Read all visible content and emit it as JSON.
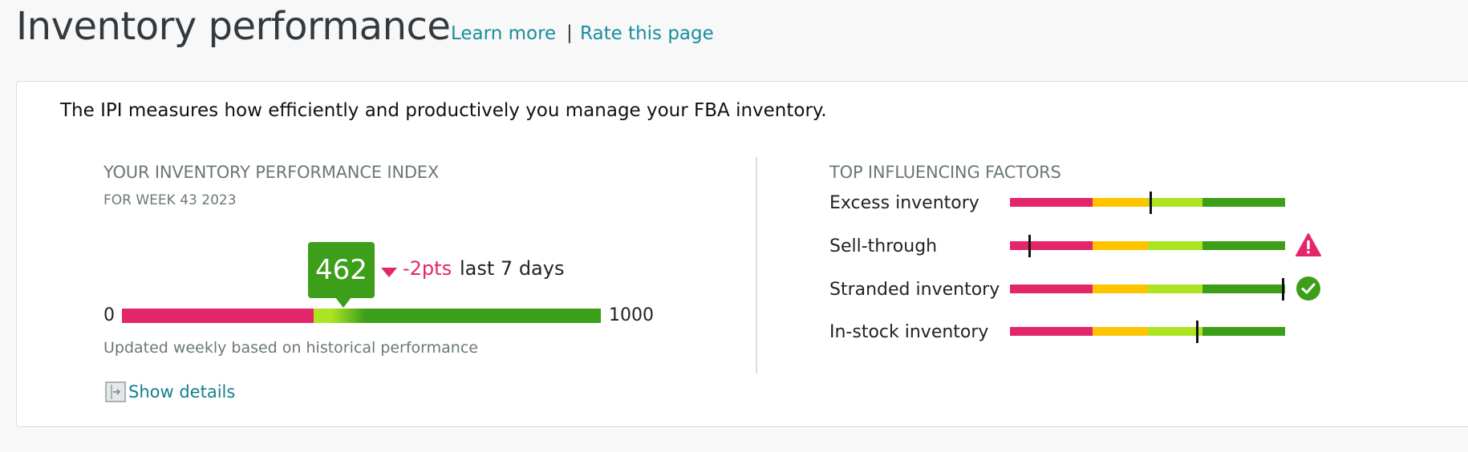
{
  "header": {
    "title": "Inventory performance",
    "learn_more": "Learn more",
    "separator": "|",
    "rate_page": "Rate this page"
  },
  "intro": "The IPI measures how efficiently and productively you manage your FBA inventory.",
  "ipi": {
    "heading": "YOUR INVENTORY PERFORMANCE INDEX",
    "period": "FOR WEEK 43 2023",
    "score": "462",
    "score_value": 462,
    "scale_min": "0",
    "scale_max": "1000",
    "scale_min_value": 0,
    "scale_max_value": 1000,
    "threshold_value": 400,
    "delta_direction": "down",
    "delta": "-2pts",
    "delta_period": "last 7 days",
    "updated_note": "Updated weekly based on historical performance",
    "show_details": "Show details",
    "colors": {
      "low": "#e3266a",
      "mid": "#ade422",
      "high": "#3d9e1a"
    }
  },
  "factors": {
    "heading": "TOP INFLUENCING FACTORS",
    "segments": [
      {
        "name": "poor",
        "fraction": 0.3,
        "color": "#e3266a"
      },
      {
        "name": "fair",
        "fraction": 0.2,
        "color": "#ffc400"
      },
      {
        "name": "good",
        "fraction": 0.2,
        "color": "#ade422"
      },
      {
        "name": "great",
        "fraction": 0.3,
        "color": "#3d9e1a"
      }
    ],
    "items": [
      {
        "label": "Excess inventory",
        "position": 0.51,
        "status": "none"
      },
      {
        "label": "Sell-through",
        "position": 0.07,
        "status": "warning"
      },
      {
        "label": "Stranded inventory",
        "position": 0.99,
        "status": "ok"
      },
      {
        "label": "In-stock inventory",
        "position": 0.68,
        "status": "none"
      }
    ]
  }
}
